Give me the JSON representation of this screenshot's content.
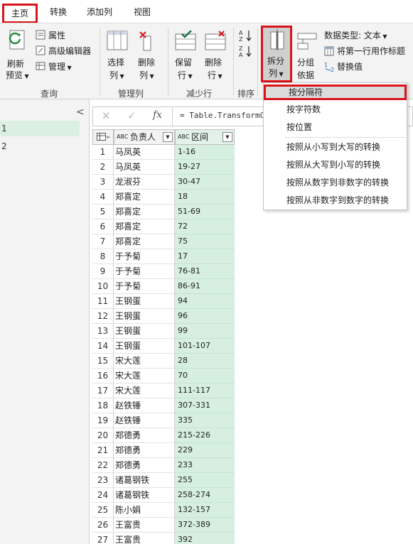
{
  "tabs": {
    "home": "主页",
    "transform": "转换",
    "add_column": "添加列",
    "view": "视图"
  },
  "ribbon": {
    "refresh_preview": [
      "刷新",
      "预览"
    ],
    "properties": "属性",
    "advanced_editor": "高级编辑器",
    "manage": "管理",
    "choose_columns": [
      "选择",
      "列"
    ],
    "remove_columns": [
      "删除",
      "列"
    ],
    "keep_rows": [
      "保留",
      "行"
    ],
    "remove_rows": [
      "删除",
      "行"
    ],
    "sort_label": "排序",
    "split_column": [
      "拆分",
      "列"
    ],
    "group_by": [
      "分组",
      "依据"
    ],
    "data_type": "数据类型: 文本",
    "use_first_row": "将第一行用作标题",
    "replace_values": "替换值",
    "groups": {
      "query": "查询",
      "manage_columns": "管理列",
      "reduce_rows": "减少行",
      "sort": "排序"
    }
  },
  "left_panel": {
    "items": [
      "1",
      "2"
    ]
  },
  "formula_bar": {
    "formula": "= Table.TransformC",
    "fx": "fx"
  },
  "grid": {
    "columns": [
      {
        "type_label": "ABC",
        "name": "负责人"
      },
      {
        "type_label": "ABC",
        "name": "区间"
      }
    ],
    "rows": [
      [
        "1",
        "马凤英",
        "1-16"
      ],
      [
        "2",
        "马凤英",
        "19-27"
      ],
      [
        "3",
        "龙淑芬",
        "30-47"
      ],
      [
        "4",
        "郑喜定",
        "18"
      ],
      [
        "5",
        "郑喜定",
        "51-69"
      ],
      [
        "6",
        "郑喜定",
        "72"
      ],
      [
        "7",
        "郑喜定",
        "75"
      ],
      [
        "8",
        "于予菊",
        "17"
      ],
      [
        "9",
        "于予菊",
        "76-81"
      ],
      [
        "10",
        "于予菊",
        "86-91"
      ],
      [
        "11",
        "王钢蛋",
        "94"
      ],
      [
        "12",
        "王钢蛋",
        "96"
      ],
      [
        "13",
        "王钢蛋",
        "99"
      ],
      [
        "14",
        "王钢蛋",
        "101-107"
      ],
      [
        "15",
        "宋大莲",
        "28"
      ],
      [
        "16",
        "宋大莲",
        "70"
      ],
      [
        "17",
        "宋大莲",
        "111-117"
      ],
      [
        "18",
        "赵铁锤",
        "307-331"
      ],
      [
        "19",
        "赵铁锤",
        "335"
      ],
      [
        "20",
        "郑德勇",
        "215-226"
      ],
      [
        "21",
        "郑德勇",
        "229"
      ],
      [
        "22",
        "郑德勇",
        "233"
      ],
      [
        "23",
        "诸葛钢铁",
        "255"
      ],
      [
        "24",
        "诸葛钢铁",
        "258-274"
      ],
      [
        "25",
        "陈小娟",
        "132-157"
      ],
      [
        "26",
        "王富贵",
        "372-389"
      ],
      [
        "27",
        "王富贵",
        "392"
      ]
    ]
  },
  "dropdown": {
    "by_delimiter": "按分隔符",
    "by_num_chars": "按字符数",
    "by_positions": "按位置",
    "lower_to_upper": "按照从小写到大写的转换",
    "upper_to_lower": "按照从大写到小写的转换",
    "digit_to_nondigit": "按照从数字到非数字的转换",
    "nondigit_to_digit": "按照从非数字到数字的转换"
  },
  "colors": {
    "highlight": "#d9141b",
    "range_column": "#d6efe1",
    "accent": "#217346"
  }
}
